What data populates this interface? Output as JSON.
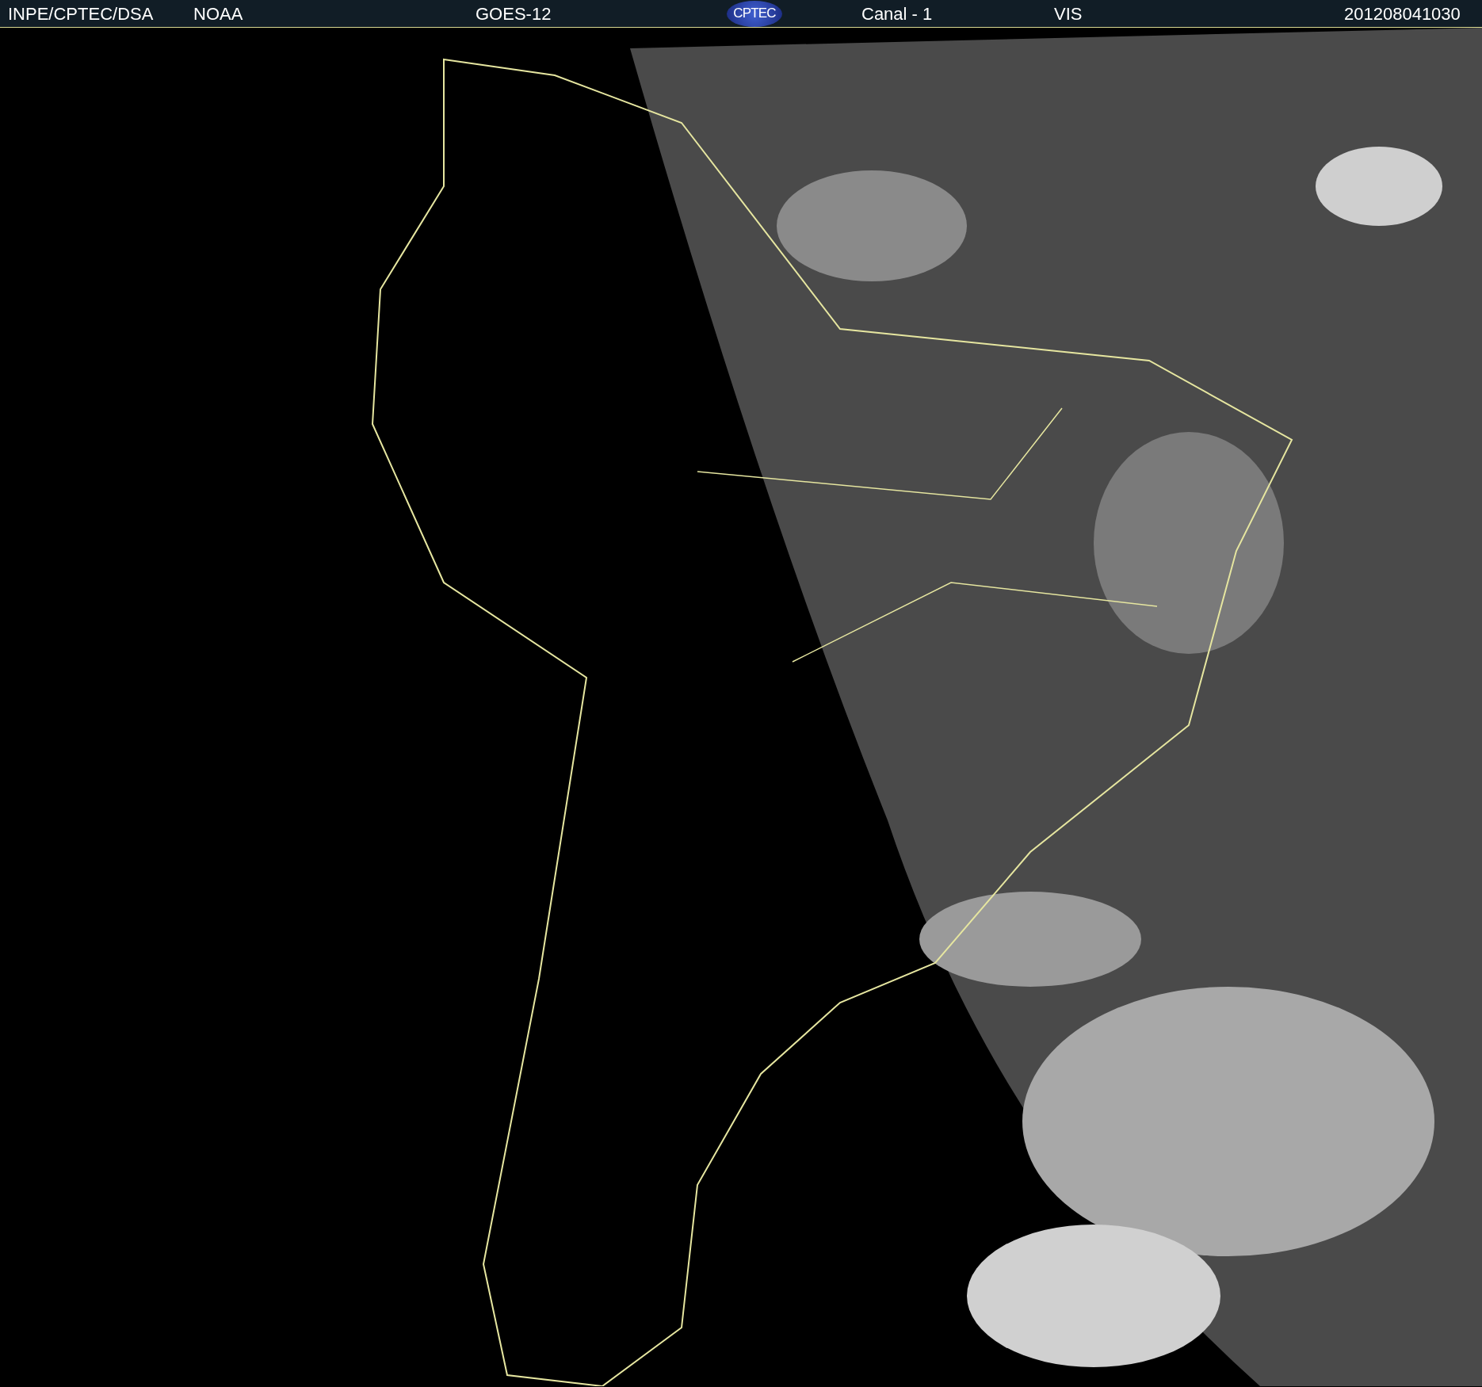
{
  "header": {
    "source": "INPE/CPTEC/DSA",
    "agency": "NOAA",
    "satellite": "GOES-12",
    "logo": "CPTEC",
    "channel": "Canal - 1",
    "band": "VIS",
    "timestamp": "201208041030"
  }
}
